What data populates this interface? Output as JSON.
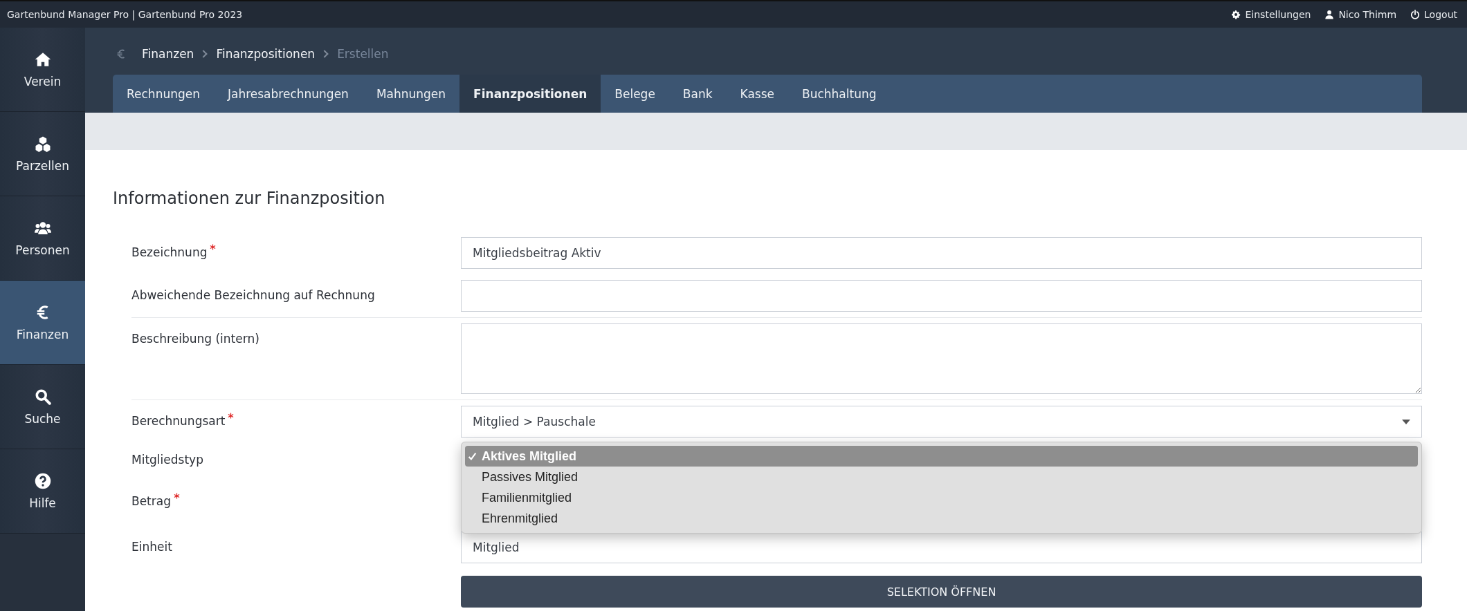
{
  "app_bar": {
    "title": "Gartenbund Manager Pro | Gartenbund Pro 2023",
    "actions": [
      {
        "kind": "settings",
        "label": "Einstellungen"
      },
      {
        "kind": "user",
        "label": "Nico Thimm"
      },
      {
        "kind": "logout",
        "label": "Logout"
      }
    ]
  },
  "sidebar": {
    "items": [
      {
        "kind": "home",
        "label": "Verein",
        "selected": false
      },
      {
        "kind": "cubes",
        "label": "Parzellen",
        "selected": false
      },
      {
        "kind": "users",
        "label": "Personen",
        "selected": false
      },
      {
        "kind": "euro",
        "label": "Finanzen",
        "selected": true
      },
      {
        "kind": "search",
        "label": "Suche",
        "selected": false
      },
      {
        "kind": "help",
        "label": "Hilfe",
        "selected": false
      }
    ]
  },
  "breadcrumb": [
    {
      "label": "Finanzen",
      "current": false
    },
    {
      "label": "Finanzpositionen",
      "current": false
    },
    {
      "label": "Erstellen",
      "current": true
    }
  ],
  "tabs": [
    {
      "label": "Rechnungen",
      "selected": false
    },
    {
      "label": "Jahresabrechnungen",
      "selected": false
    },
    {
      "label": "Mahnungen",
      "selected": false
    },
    {
      "label": "Finanzpositionen",
      "selected": true
    },
    {
      "label": "Belege",
      "selected": false
    },
    {
      "label": "Bank",
      "selected": false
    },
    {
      "label": "Kasse",
      "selected": false
    },
    {
      "label": "Buchhaltung",
      "selected": false
    }
  ],
  "form": {
    "title": "Informationen zur Finanzposition",
    "groups": [
      [
        {
          "kind": "text",
          "label": "Bezeichnung",
          "required": true,
          "value": "Mitgliedsbeitrag Aktiv"
        },
        {
          "kind": "text",
          "label": "Abweichende Bezeichnung auf Rechnung",
          "required": false
        }
      ],
      [
        {
          "kind": "textarea",
          "label": "Beschreibung (intern)",
          "required": false
        }
      ],
      [
        {
          "kind": "select",
          "label": "Berechnungsart",
          "required": true,
          "value": "Mitglied > Pauschale"
        },
        {
          "kind": "open_select",
          "label": "Mitgliedstyp",
          "required": false,
          "options": [
            {
              "label": "Aktives Mitglied",
              "selected": true
            },
            {
              "label": "Passives Mitglied",
              "selected": false
            },
            {
              "label": "Familienmitglied",
              "selected": false
            },
            {
              "label": "Ehrenmitglied",
              "selected": false
            }
          ]
        },
        {
          "kind": "covered",
          "label": "Betrag",
          "required": true
        },
        {
          "kind": "text",
          "label": "Einheit",
          "required": false,
          "value": "Mitglied"
        }
      ]
    ],
    "button": "SELEKTION ÖFFNEN"
  }
}
